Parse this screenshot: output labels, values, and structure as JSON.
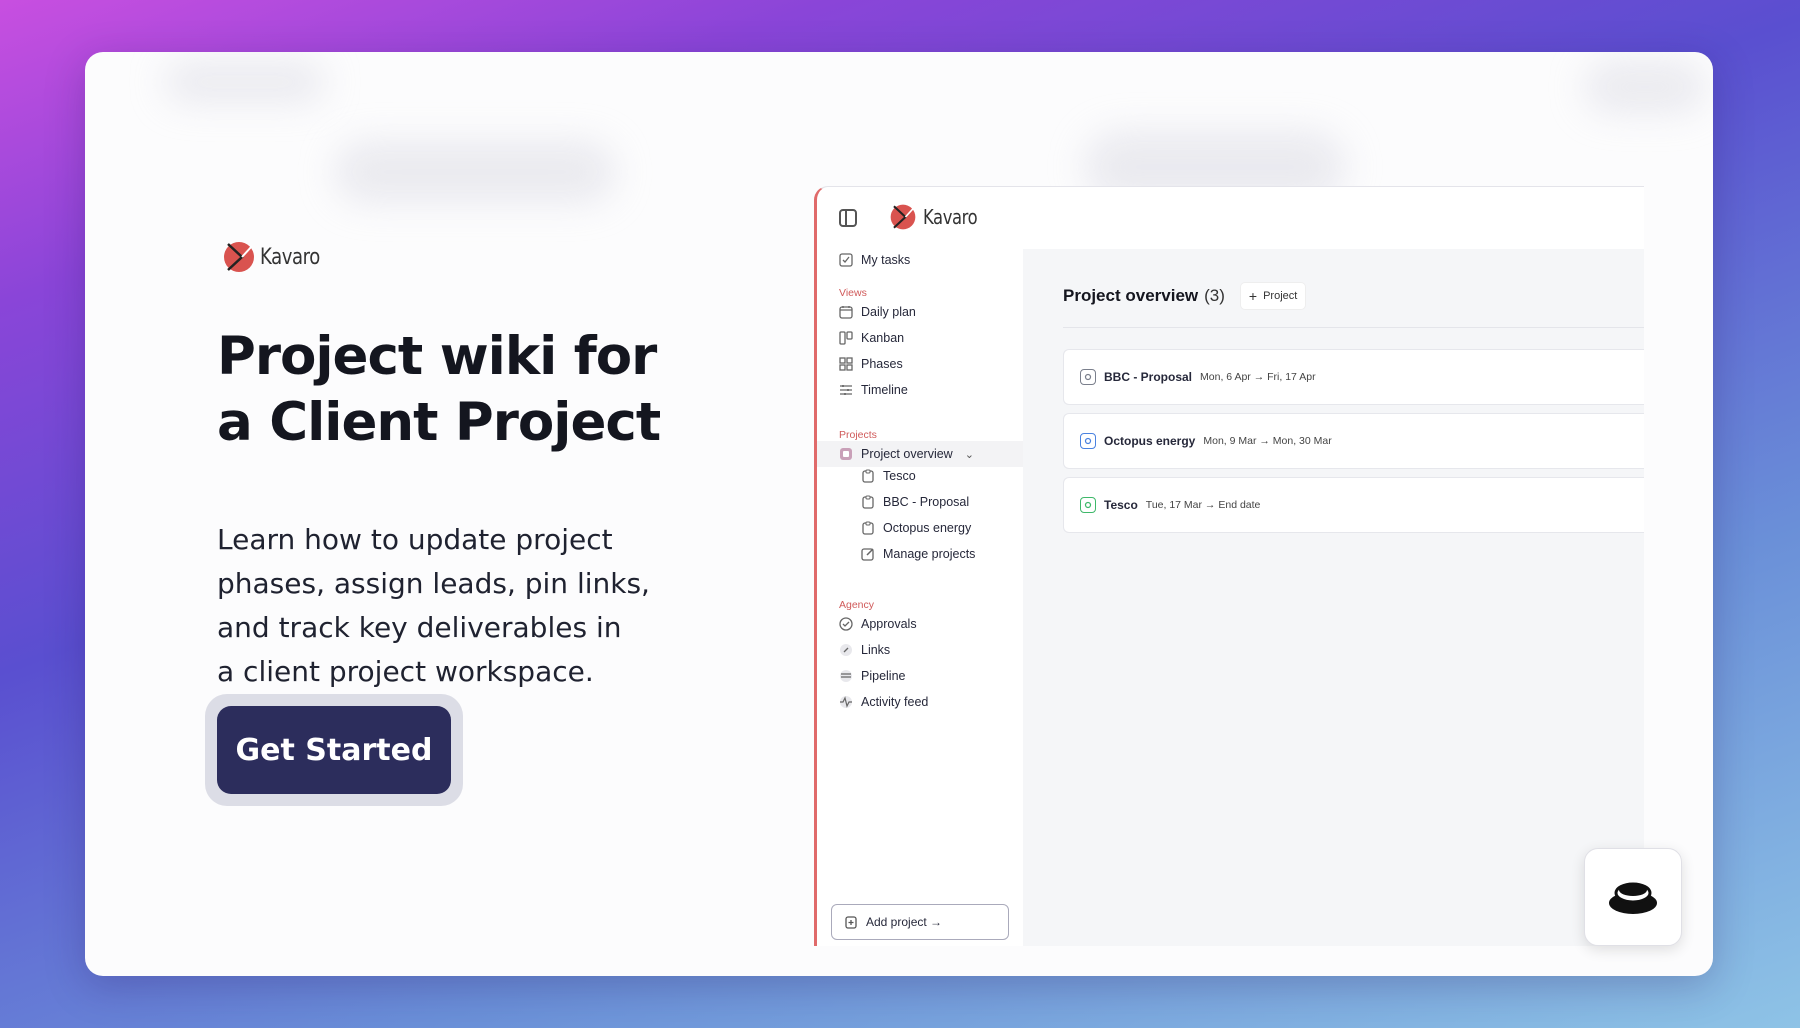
{
  "brand": {
    "name": "Kavaro"
  },
  "hero": {
    "title_line1": "Project wiki for",
    "title_line2": "a Client Project",
    "subtitle_line1": "Learn how to update project",
    "subtitle_line2": "phases, assign leads, pin links,",
    "subtitle_line3": "and track key deliverables in",
    "subtitle_line4": "a client project workspace.",
    "cta_label": "Get Started"
  },
  "app": {
    "brand_name": "Kavaro",
    "sidebar": {
      "my_tasks": "My tasks",
      "views_label": "Views",
      "views": [
        "Daily plan",
        "Kanban",
        "Phases",
        "Timeline"
      ],
      "projects_label": "Projects",
      "project_overview": "Project overview",
      "projects": [
        "Tesco",
        "BBC - Proposal",
        "Octopus energy",
        "Manage projects"
      ],
      "agency_label": "Agency",
      "agency": [
        "Approvals",
        "Links",
        "Pipeline",
        "Activity feed"
      ],
      "add_project": "Add project →"
    },
    "main": {
      "title": "Project overview",
      "count": "(3)",
      "add_button": "Project",
      "rows": [
        {
          "name": "BBC - Proposal",
          "dates": "Mon, 6 Apr → Fri, 17 Apr",
          "color": "#7a7f8c"
        },
        {
          "name": "Octopus energy",
          "dates": "Mon, 9 Mar → Mon, 30 Mar",
          "color": "#4a82e0"
        },
        {
          "name": "Tesco",
          "dates": "Tue, 17 Mar → End date",
          "color": "#3fb86a"
        }
      ]
    }
  },
  "colors": {
    "accent": "#e06a6a",
    "cta": "#2c2d5c"
  }
}
